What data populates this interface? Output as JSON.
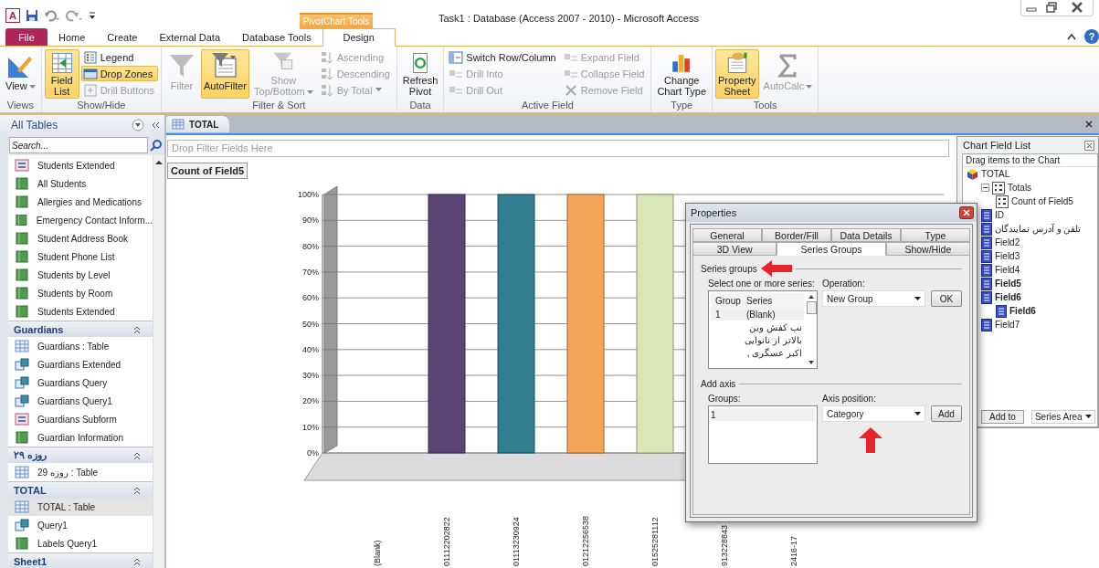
{
  "window": {
    "logo_letter": "A",
    "title": "Task1 : Database (Access 2007 - 2010)  -  Microsoft Access",
    "context_group": "PivotChart Tools",
    "help": "?"
  },
  "ribbon_tabs": [
    {
      "label": "File",
      "kind": "file",
      "selected": false
    },
    {
      "label": "Home",
      "kind": "tab",
      "selected": false
    },
    {
      "label": "Create",
      "kind": "tab",
      "selected": false
    },
    {
      "label": "External Data",
      "kind": "tab",
      "selected": false
    },
    {
      "label": "Database Tools",
      "kind": "tab",
      "selected": false
    },
    {
      "label": "Design",
      "kind": "context",
      "selected": true
    }
  ],
  "ribbon_groups": [
    {
      "label": "Views",
      "controls": [
        {
          "label": "View",
          "kind": "large",
          "on": false,
          "disabled": false,
          "dropdown": true
        }
      ]
    },
    {
      "label": "Show/Hide",
      "controls": [
        {
          "label": "Field\nList",
          "kind": "large",
          "on": true,
          "disabled": false,
          "dropdown": false
        },
        {
          "label": "Legend",
          "kind": "small",
          "on": false,
          "disabled": false,
          "dropdown": false
        },
        {
          "label": "Drop Zones",
          "kind": "small",
          "on": true,
          "disabled": false,
          "dropdown": false
        },
        {
          "label": "Drill Buttons",
          "kind": "small",
          "on": false,
          "disabled": true,
          "dropdown": false
        }
      ]
    },
    {
      "label": "Filter & Sort",
      "controls": [
        {
          "label": "Filter",
          "kind": "large",
          "on": false,
          "disabled": true,
          "dropdown": false
        },
        {
          "label": "AutoFilter",
          "kind": "large",
          "on": true,
          "disabled": false,
          "dropdown": false
        },
        {
          "label": "Show\nTop/Bottom",
          "kind": "large",
          "on": false,
          "disabled": true,
          "dropdown": true
        },
        {
          "label": "Ascending",
          "kind": "small",
          "on": false,
          "disabled": true,
          "dropdown": false
        },
        {
          "label": "Descending",
          "kind": "small",
          "on": false,
          "disabled": true,
          "dropdown": false
        },
        {
          "label": "By Total",
          "kind": "small",
          "on": false,
          "disabled": true,
          "dropdown": true
        }
      ]
    },
    {
      "label": "Data",
      "controls": [
        {
          "label": "Refresh\nPivot",
          "kind": "large",
          "on": false,
          "disabled": false,
          "dropdown": false
        }
      ]
    },
    {
      "label": "Active Field",
      "controls": [
        {
          "label": "Switch Row/Column",
          "kind": "small",
          "on": false,
          "disabled": false,
          "dropdown": false
        },
        {
          "label": "Drill Into",
          "kind": "small",
          "on": false,
          "disabled": true,
          "dropdown": false
        },
        {
          "label": "Drill Out",
          "kind": "small",
          "on": false,
          "disabled": true,
          "dropdown": false
        },
        {
          "label": "Expand Field",
          "kind": "small",
          "on": false,
          "disabled": true,
          "dropdown": false
        },
        {
          "label": "Collapse Field",
          "kind": "small",
          "on": false,
          "disabled": true,
          "dropdown": false
        },
        {
          "label": "Remove Field",
          "kind": "small",
          "on": false,
          "disabled": true,
          "dropdown": false
        }
      ]
    },
    {
      "label": "Type",
      "controls": [
        {
          "label": "Change\nChart Type",
          "kind": "large",
          "on": false,
          "disabled": false,
          "dropdown": false
        }
      ]
    },
    {
      "label": "Tools",
      "controls": [
        {
          "label": "Property\nSheet",
          "kind": "large",
          "on": true,
          "disabled": false,
          "dropdown": false
        },
        {
          "label": "AutoCalc",
          "kind": "large",
          "on": false,
          "disabled": true,
          "dropdown": true
        }
      ]
    }
  ],
  "nav": {
    "title": "All Tables",
    "search_placeholder": "Search...",
    "groups": [
      {
        "items": [
          {
            "label": "Students Extended",
            "kind": "form",
            "selected": false
          },
          {
            "label": "All Students",
            "kind": "report",
            "selected": false
          },
          {
            "label": "Allergies and Medications",
            "kind": "report",
            "selected": false
          },
          {
            "label": "Emergency Contact Inform...",
            "kind": "report",
            "selected": false
          },
          {
            "label": "Student Address Book",
            "kind": "report",
            "selected": false
          },
          {
            "label": "Student Phone List",
            "kind": "report",
            "selected": false
          },
          {
            "label": "Students by Level",
            "kind": "report",
            "selected": false
          },
          {
            "label": "Students by Room",
            "kind": "report",
            "selected": false
          },
          {
            "label": "Students Extended",
            "kind": "report",
            "selected": false
          }
        ]
      },
      {
        "label": "Guardians",
        "items": [
          {
            "label": "Guardians : Table",
            "kind": "table",
            "selected": false
          },
          {
            "label": "Guardians Extended",
            "kind": "query",
            "selected": false
          },
          {
            "label": "Guardians Query",
            "kind": "query",
            "selected": false
          },
          {
            "label": "Guardians Query1",
            "kind": "query",
            "selected": false
          },
          {
            "label": "Guardians Subform",
            "kind": "form",
            "selected": false
          },
          {
            "label": "Guardian Information",
            "kind": "report",
            "selected": false
          }
        ]
      },
      {
        "label": "روزه ۲۹",
        "items": [
          {
            "label": "روزه 29 : Table",
            "kind": "table",
            "selected": false
          }
        ]
      },
      {
        "label": "TOTAL",
        "items": [
          {
            "label": "TOTAL : Table",
            "kind": "table",
            "selected": true
          },
          {
            "label": "Query1",
            "kind": "query",
            "selected": false
          },
          {
            "label": "Labels Query1",
            "kind": "report",
            "selected": false
          }
        ]
      },
      {
        "label": "Sheet1"
      }
    ]
  },
  "document": {
    "tab": "TOTAL",
    "filter_zone": "Drop Filter Fields Here",
    "data_field": "Count of Field5",
    "chart_data": {
      "type": "bar",
      "categories": [
        "(Blank)",
        "01112202822",
        "01113230924",
        "01212256538",
        "01525281112",
        "913228843",
        "2416-17"
      ],
      "values": [
        0,
        100,
        100,
        100,
        100,
        null,
        null
      ],
      "grid": true,
      "ylim": [
        0,
        100
      ],
      "yticks": [
        {
          "value": 0,
          "label": "0%"
        },
        {
          "value": 10,
          "label": "10%"
        },
        {
          "value": 20,
          "label": "20%"
        },
        {
          "value": 30,
          "label": "30%"
        },
        {
          "value": 40,
          "label": "40%"
        },
        {
          "value": 50,
          "label": "50%"
        },
        {
          "value": 60,
          "label": "60%"
        },
        {
          "value": 70,
          "label": "70%"
        },
        {
          "value": 80,
          "label": "80%"
        },
        {
          "value": 90,
          "label": "90%"
        },
        {
          "value": 100,
          "label": "100%"
        }
      ]
    }
  },
  "field_list": {
    "title": "Chart Field List",
    "hint": "Drag items to the Chart",
    "tree": [
      {
        "label": "TOTAL",
        "kind": "source",
        "in_use": false,
        "children": [
          {
            "label": "Totals",
            "kind": "totals",
            "in_use": false,
            "children": [
              {
                "label": "Count of Field5",
                "kind": "total",
                "in_use": false
              }
            ]
          },
          {
            "label": "ID",
            "kind": "field",
            "in_use": false
          },
          {
            "label": "تلفن و آدرس نمایندگان",
            "kind": "field",
            "in_use": false
          },
          {
            "label": "Field2",
            "kind": "field",
            "in_use": false
          },
          {
            "label": "Field3",
            "kind": "field",
            "in_use": false
          },
          {
            "label": "Field4",
            "kind": "field",
            "in_use": false
          },
          {
            "label": "Field5",
            "kind": "field",
            "in_use": true
          },
          {
            "label": "Field6",
            "kind": "field",
            "in_use": true,
            "children": [
              {
                "label": "Field6",
                "kind": "field",
                "in_use": true
              }
            ]
          },
          {
            "label": "Field7",
            "kind": "field",
            "in_use": false
          }
        ]
      }
    ],
    "add_button": "Add to",
    "area_select": "Series Area"
  },
  "dialog": {
    "title": "Properties",
    "tab_rows": [
      [
        {
          "label": "General",
          "selected": false
        },
        {
          "label": "Border/Fill",
          "selected": false
        },
        {
          "label": "Data Details",
          "selected": false
        },
        {
          "label": "Type",
          "selected": false
        }
      ],
      [
        {
          "label": "3D View",
          "selected": false
        },
        {
          "label": "Series Groups",
          "selected": true
        },
        {
          "label": "Show/Hide",
          "selected": false
        }
      ]
    ],
    "series_section": "Series groups",
    "series_prompt": "Select one or more series:",
    "series_columns": [
      "Group",
      "Series"
    ],
    "series_rows": [
      {
        "group": "1",
        "series": "(Blank)",
        "selected": true
      },
      {
        "series": "نب کفش وین",
        "selected": false
      },
      {
        "series": "بالاتر از نانوایی",
        "selected": false
      },
      {
        "series": "اکبر عسگری ,",
        "selected": false
      }
    ],
    "operation_label": "Operation:",
    "operation_value": "New Group",
    "ok_button": "OK",
    "axis_section": "Add axis",
    "groups_label": "Groups:",
    "groups_items": [
      "1"
    ],
    "axis_label": "Axis position:",
    "axis_value": "Category",
    "add_button": "Add"
  }
}
